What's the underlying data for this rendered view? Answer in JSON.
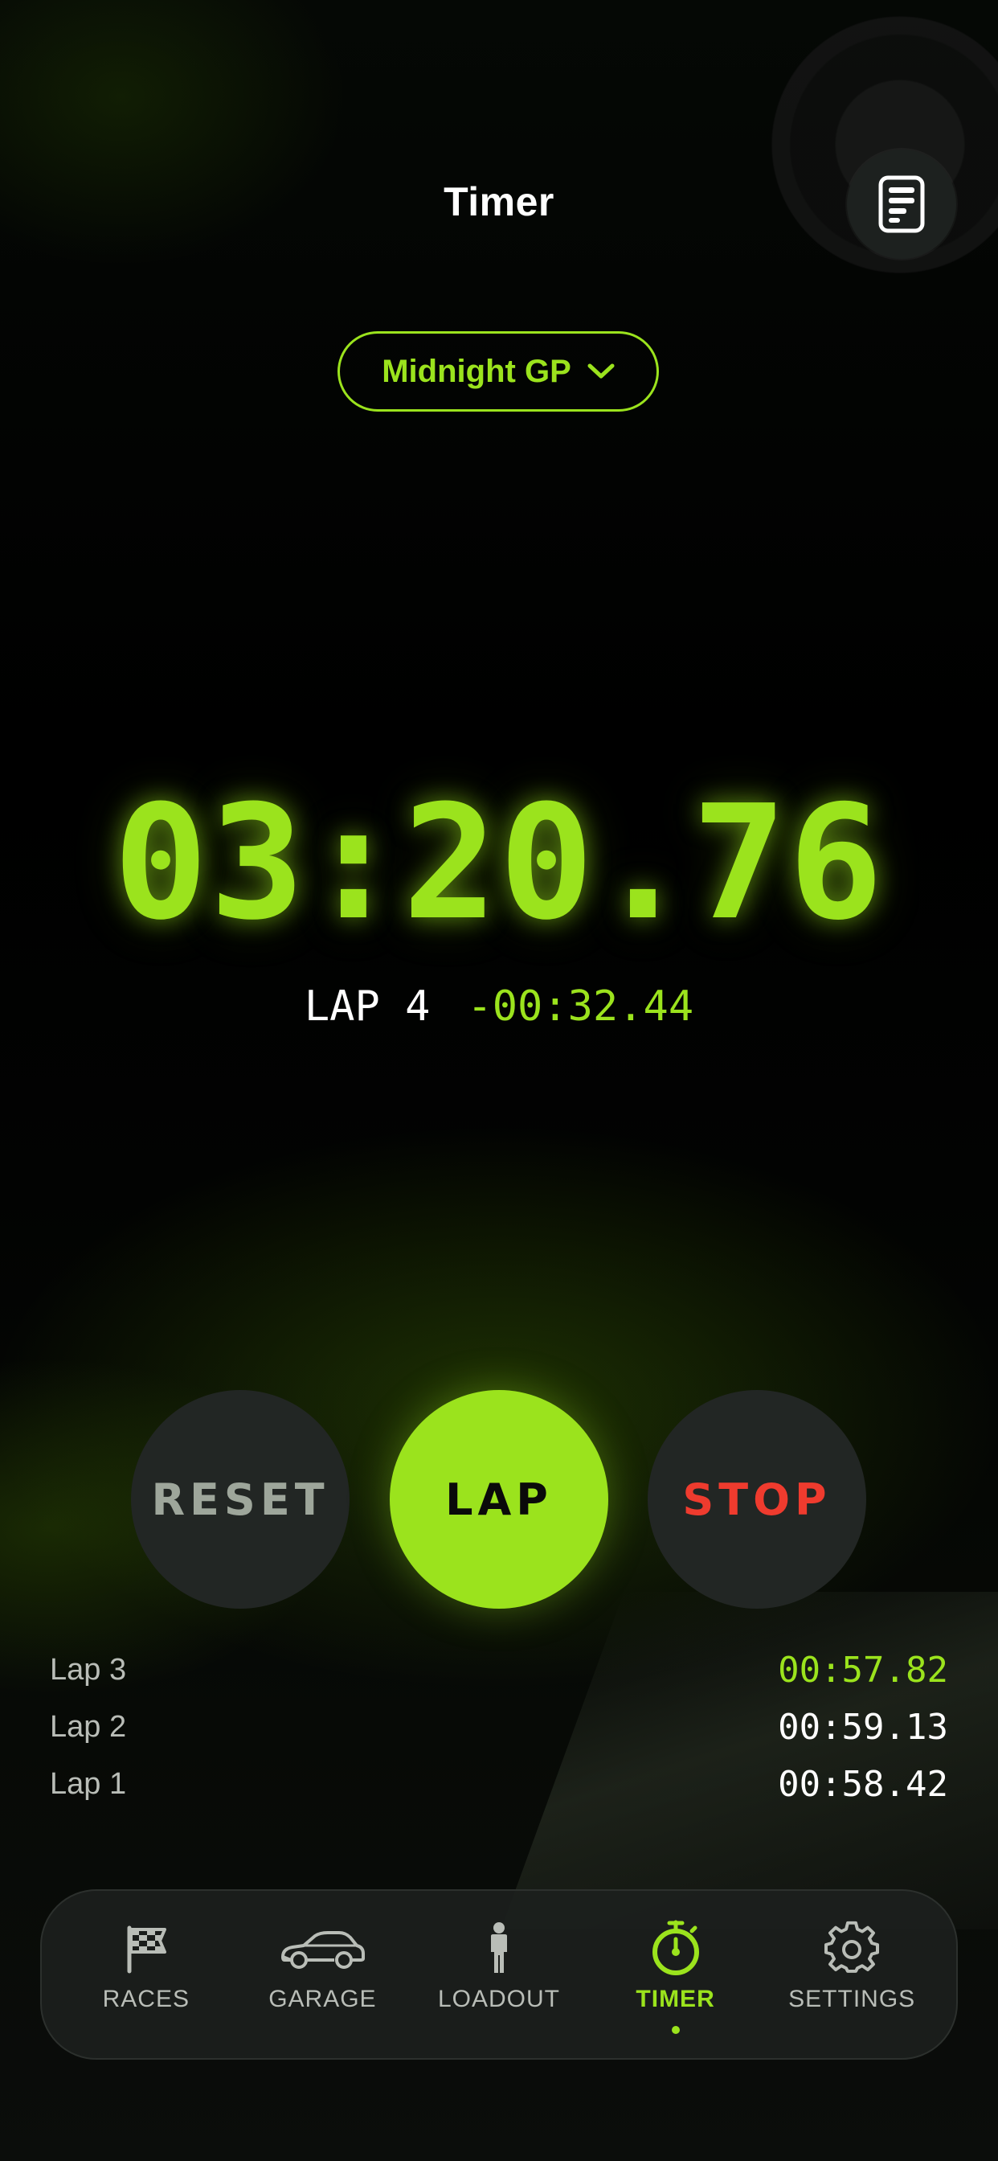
{
  "header": {
    "title": "Timer",
    "log_icon": "list-document-icon"
  },
  "race_selector": {
    "value": "Midnight GP",
    "icon": "chevron-down-icon"
  },
  "timer": {
    "time": "03:20.76",
    "current_lap": "LAP 4",
    "delta": "-00:32.44"
  },
  "controls": {
    "reset_label": "RESET",
    "lap_label": "LAP",
    "stop_label": "STOP"
  },
  "laps": [
    {
      "name": "Lap 3",
      "time": "00:57.82",
      "best": true
    },
    {
      "name": "Lap 2",
      "time": "00:59.13",
      "best": false
    },
    {
      "name": "Lap 1",
      "time": "00:58.42",
      "best": false
    }
  ],
  "tabbar": {
    "items": [
      {
        "label": "RACES",
        "icon": "checkered-flag-icon"
      },
      {
        "label": "GARAGE",
        "icon": "car-icon"
      },
      {
        "label": "LOADOUT",
        "icon": "person-icon"
      },
      {
        "label": "TIMER",
        "icon": "stopwatch-icon",
        "active": true
      },
      {
        "label": "SETTINGS",
        "icon": "gear-icon"
      }
    ]
  },
  "colors": {
    "accent": "#9be31d",
    "stop": "#ef3b2e",
    "button_bg": "#222624"
  }
}
